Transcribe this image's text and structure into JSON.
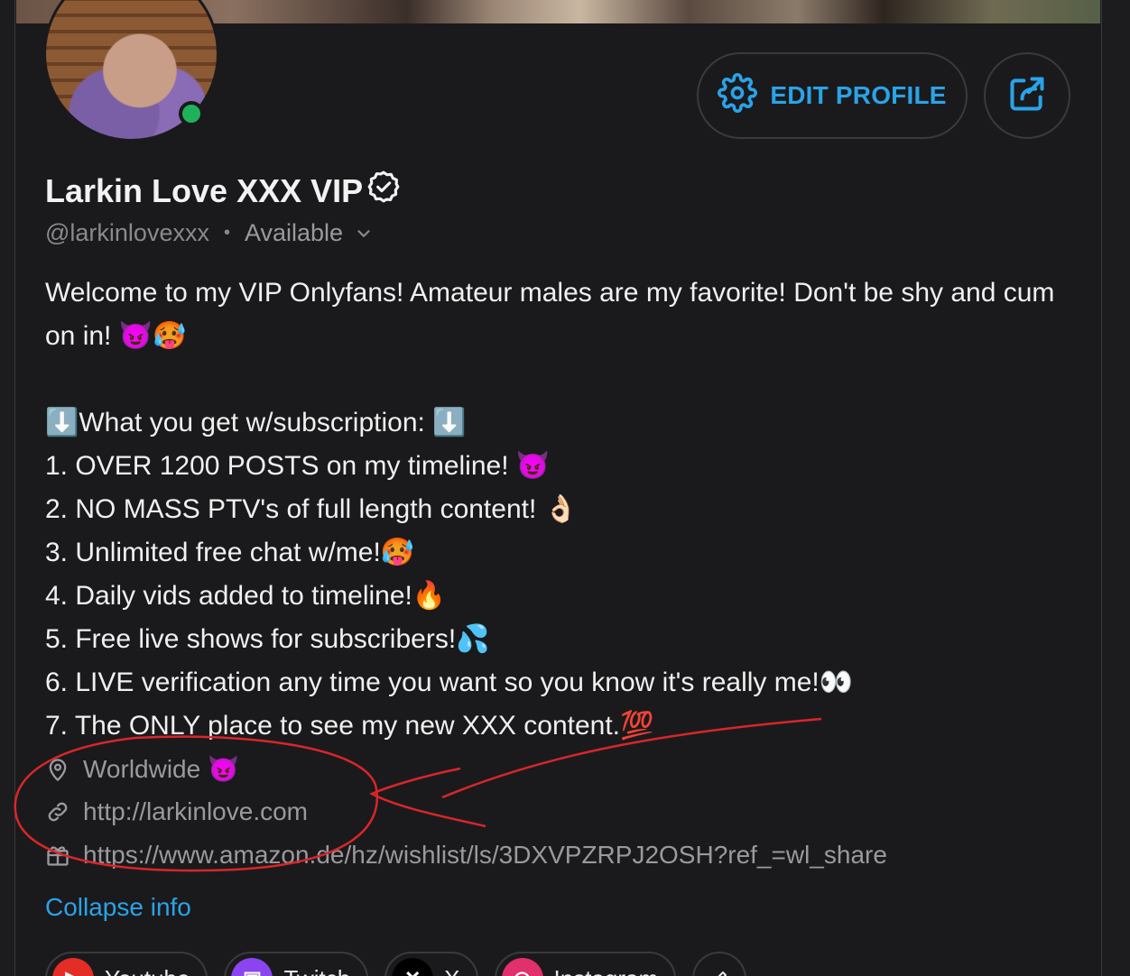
{
  "profile": {
    "name": "Larkin Love XXX VIP",
    "handle": "@larkinlovexxx",
    "separator": "•",
    "status": "Available"
  },
  "actions": {
    "edit_label": "EDIT PROFILE"
  },
  "bio": {
    "line1": "Welcome to my VIP Onlyfans! Amateur males are my favorite! Don't be shy and cum on in! 😈🥵",
    "heading": "⬇️What you get w/subscription: ⬇️",
    "items": [
      "1. OVER 1200 POSTS on my timeline! 😈",
      "2. NO MASS PTV's of full length content! 👌🏻",
      "3. Unlimited free chat w/me!🥵",
      "4. Daily vids added to timeline!🔥",
      "5. Free live shows for subscribers!💦",
      "6. LIVE verification any time you want so you know it's really me!👀",
      "7. The ONLY place to see my new XXX content.💯"
    ]
  },
  "meta": {
    "location": "Worldwide 😈",
    "website": "http://larkinlove.com",
    "wishlist": "https://www.amazon.de/hz/wishlist/ls/3DXVPZRPJ2OSH?ref_=wl_share"
  },
  "collapse_label": "Collapse info",
  "socials": [
    {
      "label": "Youtube",
      "icon": "youtube-icon",
      "color": "#e52d27"
    },
    {
      "label": "Twitch",
      "icon": "twitch-icon",
      "color": "#8b45f0"
    },
    {
      "label": "X",
      "icon": "x-icon",
      "color": "#000000"
    },
    {
      "label": "Instagram",
      "icon": "instagram-icon",
      "color": "#e1306c"
    }
  ],
  "colors": {
    "accent": "#2aa3e8",
    "background": "#1a1a1c",
    "online": "#1fb25a",
    "annotation": "#d8262a"
  }
}
